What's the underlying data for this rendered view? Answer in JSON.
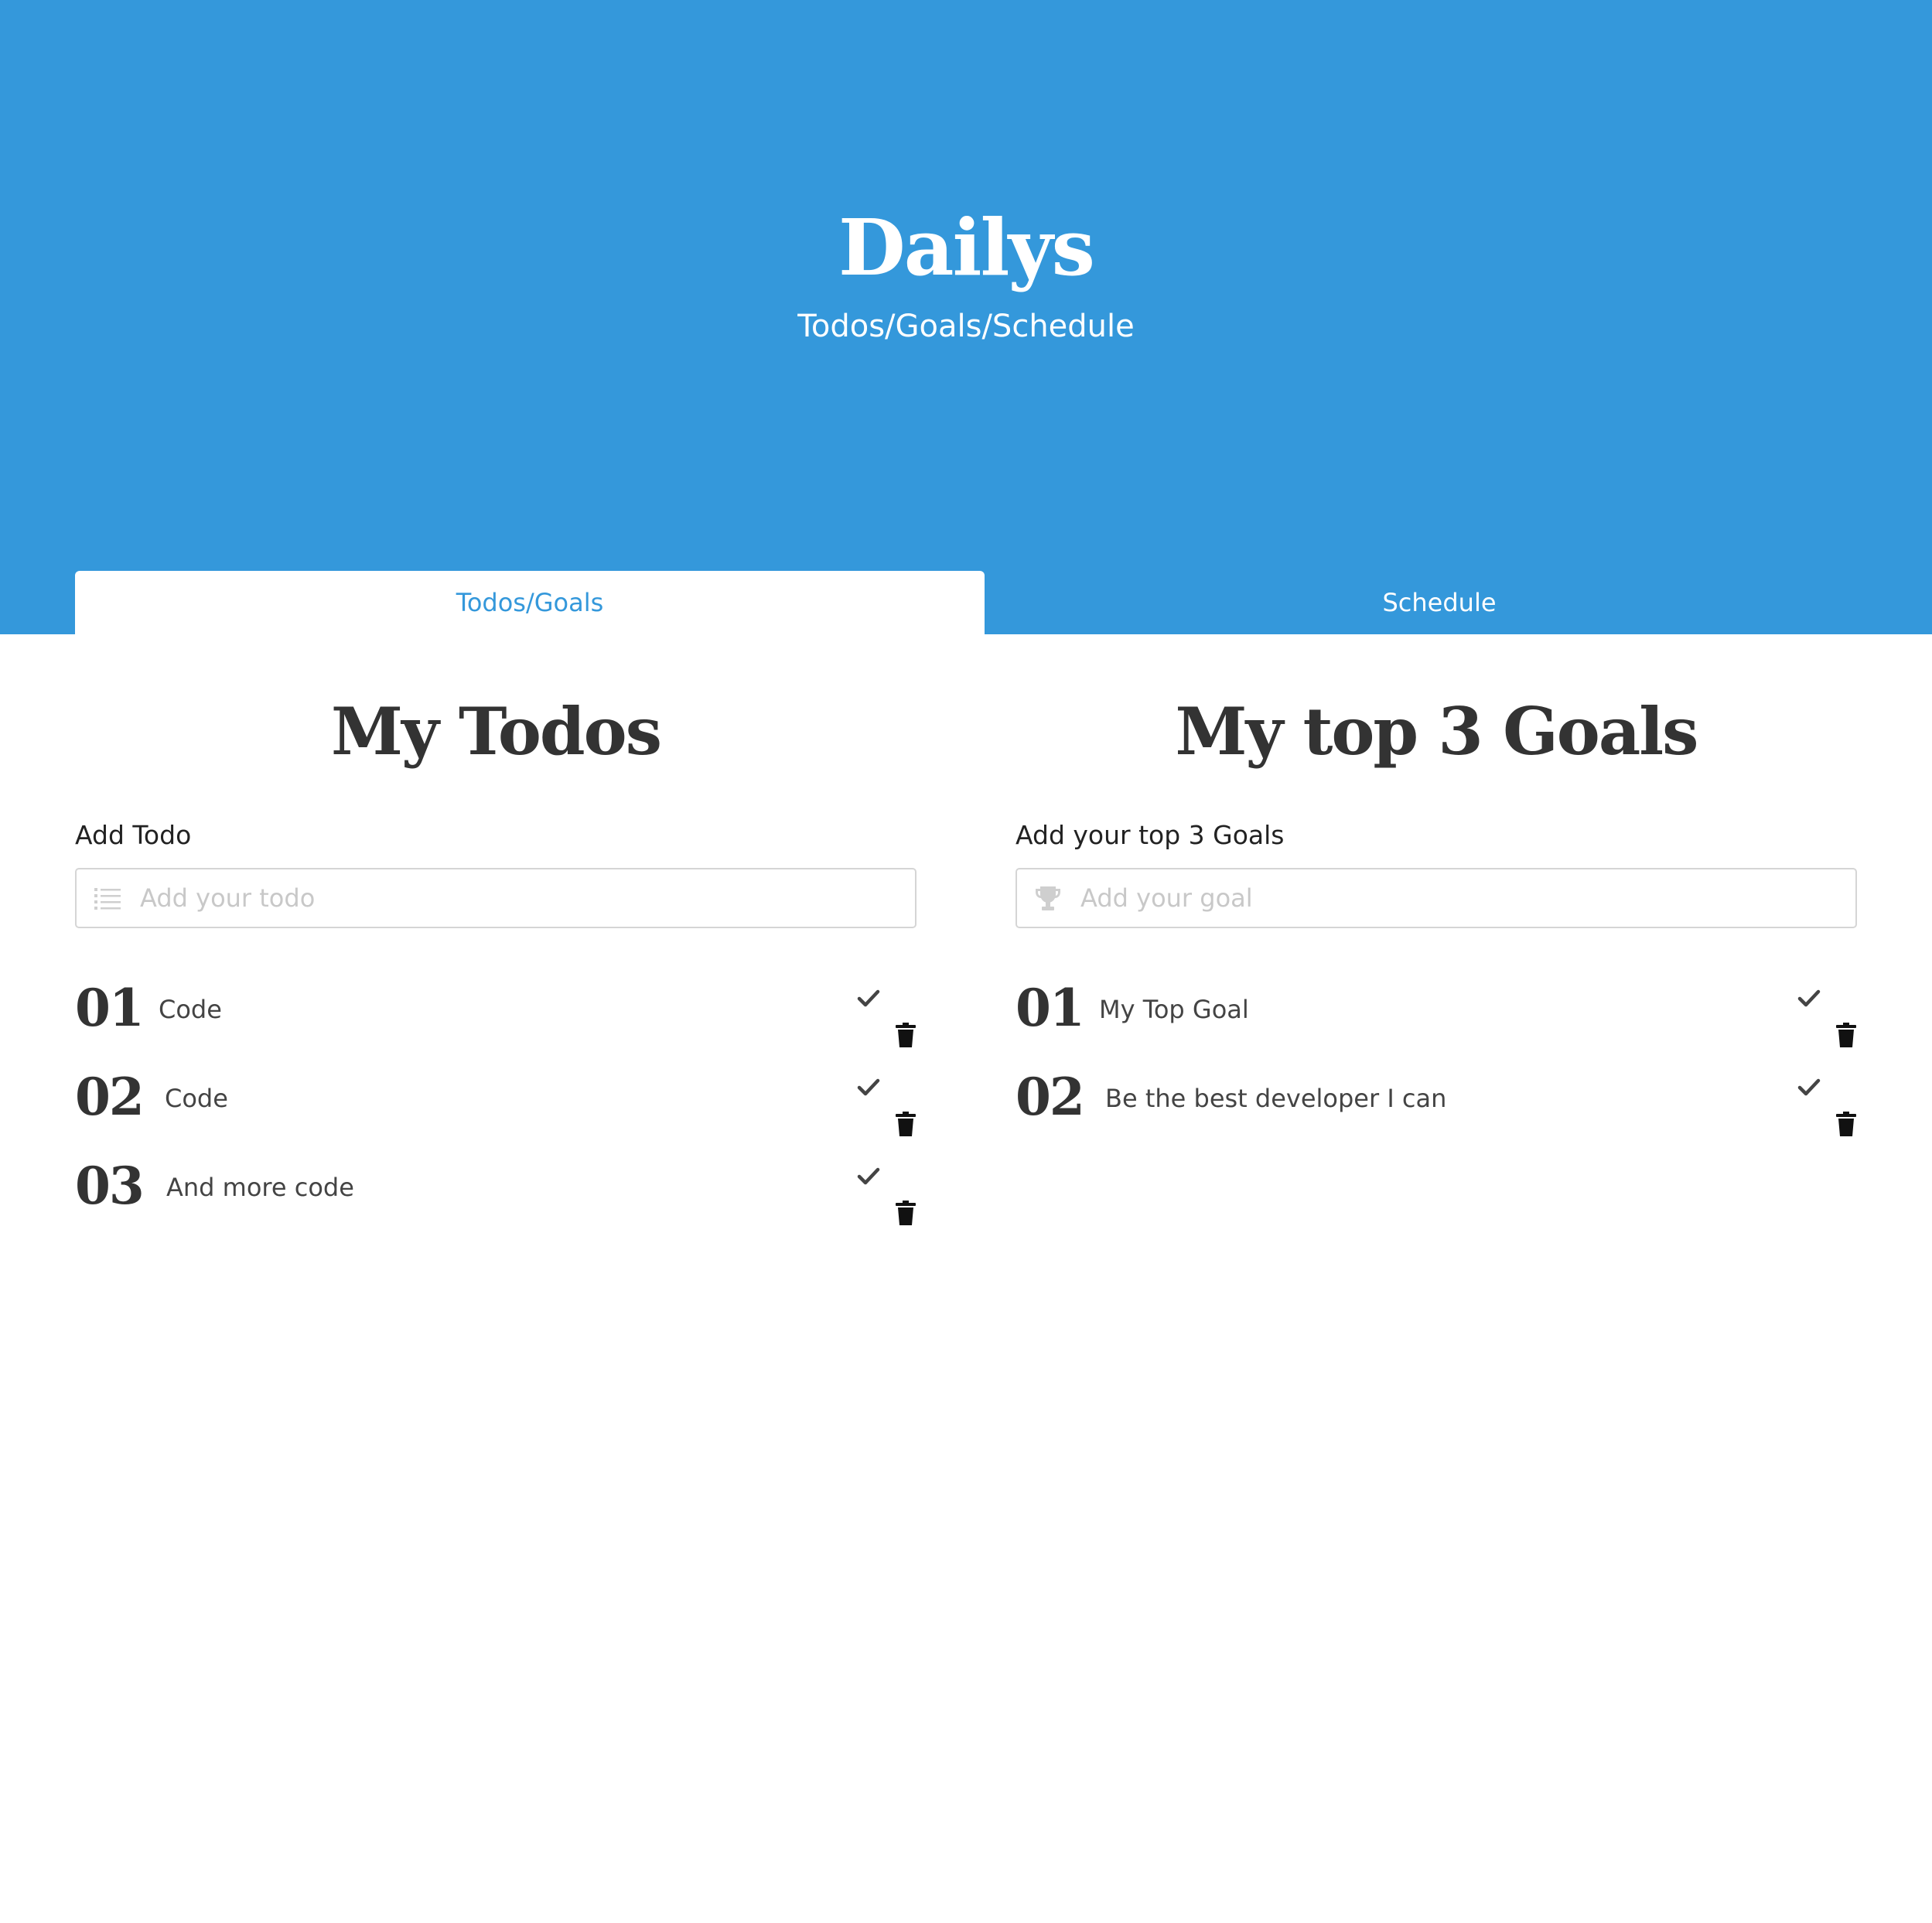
{
  "header": {
    "title": "Dailys",
    "subtitle": "Todos/Goals/Schedule",
    "background_color": "#3498db"
  },
  "tabs": [
    {
      "label": "Todos/Goals",
      "active": true
    },
    {
      "label": "Schedule",
      "active": false
    }
  ],
  "todos": {
    "title": "My Todos",
    "input_label": "Add Todo",
    "input_placeholder": "Add your todo",
    "input_icon": "list-icon",
    "items": [
      {
        "number": "01",
        "text": "Code"
      },
      {
        "number": "02",
        "text": "Code"
      },
      {
        "number": "03",
        "text": "And more code"
      }
    ]
  },
  "goals": {
    "title": "My top 3 Goals",
    "input_label": "Add your top 3 Goals",
    "input_placeholder": "Add your goal",
    "input_icon": "trophy-icon",
    "items": [
      {
        "number": "01",
        "text": "My Top Goal"
      },
      {
        "number": "02",
        "text": "Be the best developer I can"
      }
    ]
  },
  "icons": {
    "complete": "check-icon",
    "delete": "trash-icon"
  },
  "colors": {
    "accent": "#3498db",
    "text": "#333333",
    "placeholder": "#c8c8c8"
  }
}
